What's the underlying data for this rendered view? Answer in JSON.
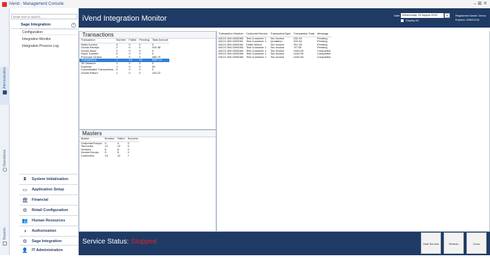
{
  "app": {
    "title": "iVend - Management Console",
    "window_controls": "–   ⊠  ✕"
  },
  "nav_strip": {
    "administration": "Administration",
    "operations": "Operations",
    "reports": "Reports"
  },
  "sidebar": {
    "search_placeholder": "Enter text to search...",
    "section": "Sage Integration",
    "collapse": "«",
    "items": [
      {
        "label": "Configuration"
      },
      {
        "label": "Integration Monitor"
      },
      {
        "label": "Integration Process Log"
      }
    ],
    "categories": [
      {
        "label": "System Initialization",
        "icon": "hourglass-icon",
        "glyph": "⧗"
      },
      {
        "label": "Application Setup",
        "icon": "window-icon",
        "glyph": "▭"
      },
      {
        "label": "Financial",
        "icon": "bank-icon",
        "glyph": "🏛"
      },
      {
        "label": "Retail Configuration",
        "icon": "settings-icon",
        "glyph": "⚙"
      },
      {
        "label": "Human Resources",
        "icon": "people-icon",
        "glyph": "👥"
      },
      {
        "label": "Authorization",
        "icon": "shield-icon",
        "glyph": "◑"
      },
      {
        "label": "Sage Integration",
        "icon": "gear-icon",
        "glyph": "⚙"
      },
      {
        "label": "IT Administration",
        "icon": "user-icon",
        "glyph": "👤"
      }
    ]
  },
  "header": {
    "title": "iVend Integration Monitor",
    "date_label": "Date",
    "date_value": "Wednesday, 24   August   2016",
    "date_button": "▾",
    "display_all": "Display All",
    "registered": "Registered Name:  Demo",
    "expires": "Expires:   20/6/12/16"
  },
  "transactions": {
    "title": "Transactions",
    "columns": [
      "Transaction",
      "Number",
      "Failed",
      "Pending",
      "Total Amount"
    ],
    "rows": [
      [
        "Sales Invoice",
        "3",
        "0",
        "0",
        "3"
      ],
      [
        "Goods Receipt",
        "2",
        "0",
        "0",
        "204.38"
      ],
      [
        "Goods Issue",
        "2",
        "0",
        "0",
        "0"
      ],
      [
        "Stock Transfer",
        "0",
        "0",
        "0",
        "0"
      ],
      [
        "Purchase Orders",
        "3",
        "0",
        "0",
        "486.79"
      ],
      [
        "Transactions",
        "7",
        "13",
        "13",
        "5687.41"
      ],
      [
        "Till Variance",
        "1",
        "0",
        "0",
        "0"
      ],
      [
        "Expense",
        "1",
        "0",
        "0",
        "50"
      ],
      [
        "Consolidated Transactions",
        "0",
        "0",
        "0",
        "0"
      ],
      [
        "Goods Return",
        "1",
        "0",
        "0",
        "100.22"
      ]
    ],
    "selected_index": 5
  },
  "masters": {
    "title": "Masters",
    "columns": [
      "Master",
      "Number",
      "Failed",
      "Success"
    ],
    "rows": [
      [
        "CustomerGroups",
        "4",
        "4",
        "0"
      ],
      [
        "TaxCodes",
        "12",
        "12",
        "0"
      ],
      [
        "Vendors",
        "8",
        "8",
        "0"
      ],
      [
        "VendorGroups",
        "5",
        "5",
        "0"
      ],
      [
        "Customers",
        "19",
        "12",
        "7"
      ]
    ]
  },
  "details": {
    "columns": [
      "Transaction Number",
      "Customer/Vendor",
      "TransactionType",
      "Transaction Total",
      "Message"
    ],
    "rows": [
      [
        "ASCO-INV-0000060",
        "Test Customer 1",
        "Tax Invoice",
        "232.94",
        "Pending"
      ],
      [
        "ASCO-INV-0000061",
        "Test Customer 1",
        "Quotation",
        "310.64",
        "Pending"
      ],
      [
        "ASCO-INV-0000062",
        "Eddie Wilcox",
        "Tax Invoice",
        "291.35",
        "Pending"
      ],
      [
        "ASCO-INV-0000063",
        "Test Customer 1",
        "Tax Invoice",
        "-97.55",
        "Pending"
      ],
      [
        "ASCO-INV-0000064",
        "Test Customer 1",
        "Tax Invoice",
        "1040.00",
        "Completed"
      ],
      [
        "ASCO-INV-0000065",
        "Test Customer 1",
        "Tax Invoice",
        "1040.00",
        "Completed"
      ],
      [
        "ASCO-INV-0000066",
        "Test Customer 1",
        "Tax Invoice",
        "1040.00",
        "Completed"
      ]
    ]
  },
  "status": {
    "label": "Service Status:",
    "value": "Stopped",
    "buttons": {
      "start": "Start Service",
      "refresh": "Refresh",
      "close": "Close"
    }
  }
}
